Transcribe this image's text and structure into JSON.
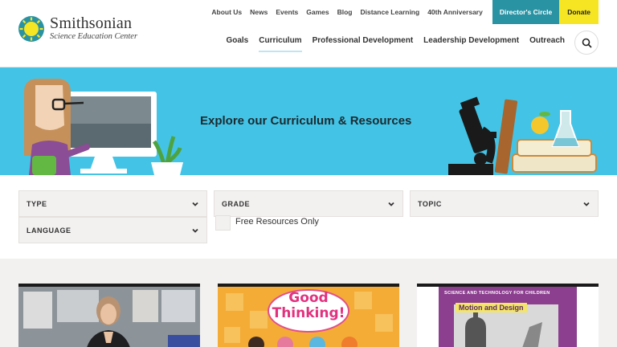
{
  "header": {
    "logo_name": "Smithsonian",
    "logo_sub": "Science Education Center",
    "utility_links": [
      "About Us",
      "News",
      "Events",
      "Games",
      "Blog",
      "Distance Learning",
      "40th Anniversary"
    ],
    "directors_circle": "Director's Circle",
    "donate": "Donate",
    "main_nav": [
      "Goals",
      "Curriculum",
      "Professional Development",
      "Leadership Development",
      "Outreach"
    ],
    "active_nav": "Curriculum"
  },
  "banner": {
    "title": "Explore our Curriculum & Resources"
  },
  "filters": {
    "type": "TYPE",
    "grade": "GRADE",
    "topic": "TOPIC",
    "language": "LANGUAGE",
    "free_resources_label": "Free Resources Only",
    "free_resources_checked": false
  },
  "cards": {
    "card2": {
      "title_line1": "Good",
      "title_line2": "Thinking!"
    },
    "card3": {
      "series": "Science and Technology for Children",
      "title": "Motion and Design"
    }
  },
  "colors": {
    "accent_teal": "#2a93a3",
    "donate_yellow": "#f6e523",
    "banner_blue": "#43c4e6"
  }
}
